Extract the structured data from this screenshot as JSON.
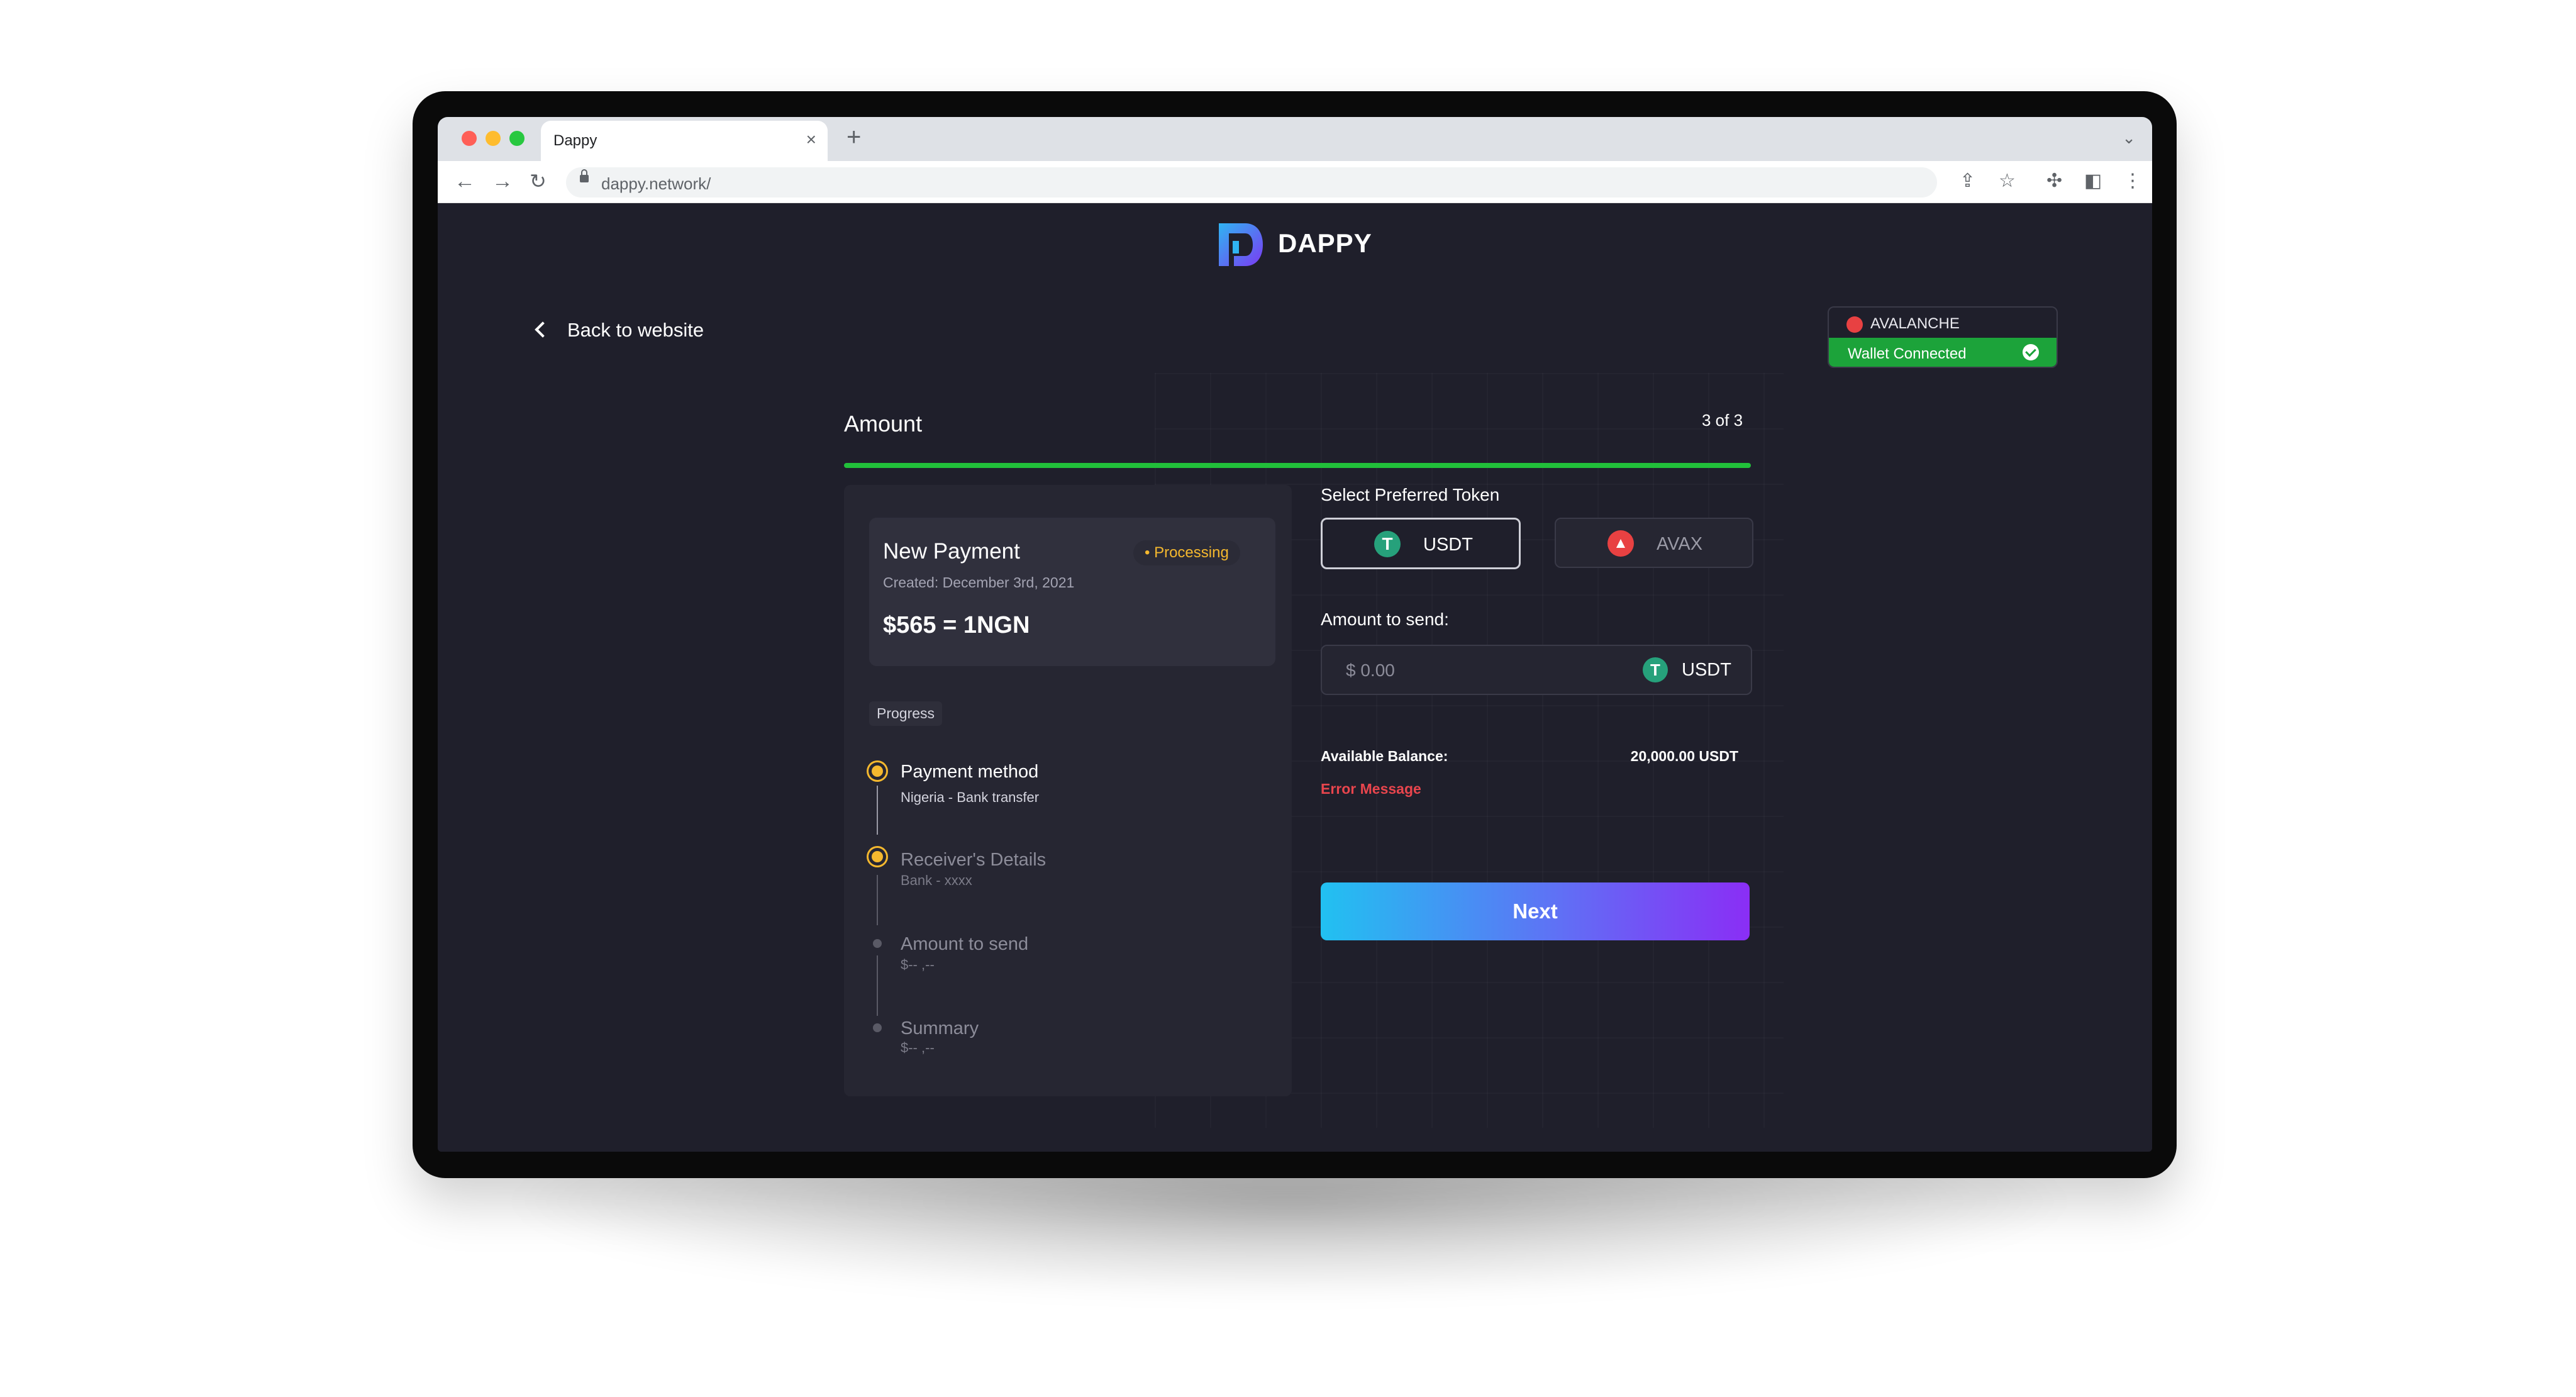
{
  "browser": {
    "tab_title": "Dappy",
    "url": "dappy.network/"
  },
  "brand": {
    "name": "DAPPY"
  },
  "nav": {
    "back_label": "Back to website"
  },
  "network": {
    "name": "AVALANCHE",
    "status": "Wallet Connected"
  },
  "flow": {
    "heading": "Amount",
    "step": "3 of 3",
    "progress_fraction": 1.0
  },
  "payment": {
    "title": "New Payment",
    "status": "• Processing",
    "created": "Created: December 3rd, 2021",
    "amount": "$565 =  1NGN"
  },
  "progress": {
    "label": "Progress",
    "steps": [
      {
        "title": "Payment method",
        "sub": "Nigeria - Bank transfer"
      },
      {
        "title": "Receiver's Details",
        "sub": "Bank - xxxx"
      },
      {
        "title": "Amount to send",
        "sub": "$-- ,--"
      },
      {
        "title": "Summary",
        "sub": "$-- ,--"
      }
    ]
  },
  "form": {
    "token_label": "Select Preferred Token",
    "tokens": [
      {
        "symbol": "USDT",
        "icon": "tether-icon",
        "color": "#26a17b",
        "selected": true
      },
      {
        "symbol": "AVAX",
        "icon": "avalanche-icon",
        "color": "#e84142",
        "selected": false
      }
    ],
    "amount_label": "Amount to send:",
    "amount_placeholder": "$ 0.00",
    "amount_token": "USDT",
    "balance_label": "Available Balance:",
    "balance_value": "20,000.00 USDT",
    "error": "Error Message",
    "next_label": "Next"
  },
  "colors": {
    "page_bg": "#1f1f2b",
    "accent_green": "#21c03a",
    "processing": "#f5b82e",
    "error": "#e8454d",
    "button_gradient_start": "#21c1f1",
    "button_gradient_end": "#8a2ef5"
  }
}
